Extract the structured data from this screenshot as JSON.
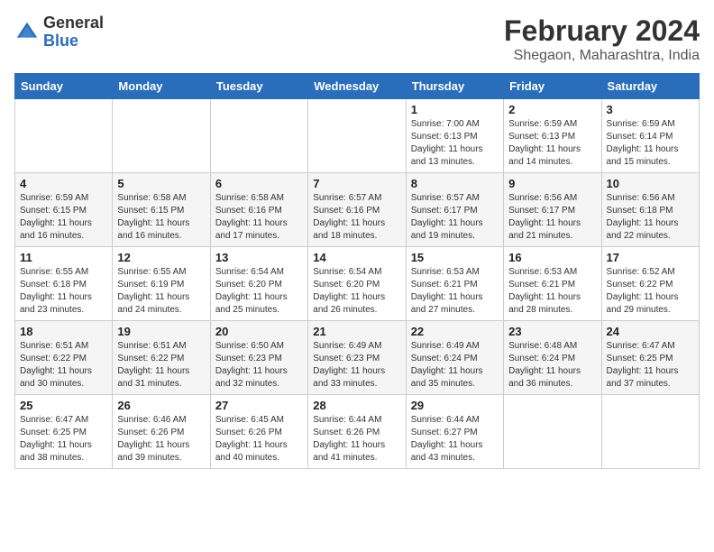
{
  "app": {
    "logo_general": "General",
    "logo_blue": "Blue"
  },
  "title": "February 2024",
  "location": "Shegaon, Maharashtra, India",
  "weekdays": [
    "Sunday",
    "Monday",
    "Tuesday",
    "Wednesday",
    "Thursday",
    "Friday",
    "Saturday"
  ],
  "weeks": [
    [
      {
        "day": "",
        "info": ""
      },
      {
        "day": "",
        "info": ""
      },
      {
        "day": "",
        "info": ""
      },
      {
        "day": "",
        "info": ""
      },
      {
        "day": "1",
        "info": "Sunrise: 7:00 AM\nSunset: 6:13 PM\nDaylight: 11 hours\nand 13 minutes."
      },
      {
        "day": "2",
        "info": "Sunrise: 6:59 AM\nSunset: 6:13 PM\nDaylight: 11 hours\nand 14 minutes."
      },
      {
        "day": "3",
        "info": "Sunrise: 6:59 AM\nSunset: 6:14 PM\nDaylight: 11 hours\nand 15 minutes."
      }
    ],
    [
      {
        "day": "4",
        "info": "Sunrise: 6:59 AM\nSunset: 6:15 PM\nDaylight: 11 hours\nand 16 minutes."
      },
      {
        "day": "5",
        "info": "Sunrise: 6:58 AM\nSunset: 6:15 PM\nDaylight: 11 hours\nand 16 minutes."
      },
      {
        "day": "6",
        "info": "Sunrise: 6:58 AM\nSunset: 6:16 PM\nDaylight: 11 hours\nand 17 minutes."
      },
      {
        "day": "7",
        "info": "Sunrise: 6:57 AM\nSunset: 6:16 PM\nDaylight: 11 hours\nand 18 minutes."
      },
      {
        "day": "8",
        "info": "Sunrise: 6:57 AM\nSunset: 6:17 PM\nDaylight: 11 hours\nand 19 minutes."
      },
      {
        "day": "9",
        "info": "Sunrise: 6:56 AM\nSunset: 6:17 PM\nDaylight: 11 hours\nand 21 minutes."
      },
      {
        "day": "10",
        "info": "Sunrise: 6:56 AM\nSunset: 6:18 PM\nDaylight: 11 hours\nand 22 minutes."
      }
    ],
    [
      {
        "day": "11",
        "info": "Sunrise: 6:55 AM\nSunset: 6:18 PM\nDaylight: 11 hours\nand 23 minutes."
      },
      {
        "day": "12",
        "info": "Sunrise: 6:55 AM\nSunset: 6:19 PM\nDaylight: 11 hours\nand 24 minutes."
      },
      {
        "day": "13",
        "info": "Sunrise: 6:54 AM\nSunset: 6:20 PM\nDaylight: 11 hours\nand 25 minutes."
      },
      {
        "day": "14",
        "info": "Sunrise: 6:54 AM\nSunset: 6:20 PM\nDaylight: 11 hours\nand 26 minutes."
      },
      {
        "day": "15",
        "info": "Sunrise: 6:53 AM\nSunset: 6:21 PM\nDaylight: 11 hours\nand 27 minutes."
      },
      {
        "day": "16",
        "info": "Sunrise: 6:53 AM\nSunset: 6:21 PM\nDaylight: 11 hours\nand 28 minutes."
      },
      {
        "day": "17",
        "info": "Sunrise: 6:52 AM\nSunset: 6:22 PM\nDaylight: 11 hours\nand 29 minutes."
      }
    ],
    [
      {
        "day": "18",
        "info": "Sunrise: 6:51 AM\nSunset: 6:22 PM\nDaylight: 11 hours\nand 30 minutes."
      },
      {
        "day": "19",
        "info": "Sunrise: 6:51 AM\nSunset: 6:22 PM\nDaylight: 11 hours\nand 31 minutes."
      },
      {
        "day": "20",
        "info": "Sunrise: 6:50 AM\nSunset: 6:23 PM\nDaylight: 11 hours\nand 32 minutes."
      },
      {
        "day": "21",
        "info": "Sunrise: 6:49 AM\nSunset: 6:23 PM\nDaylight: 11 hours\nand 33 minutes."
      },
      {
        "day": "22",
        "info": "Sunrise: 6:49 AM\nSunset: 6:24 PM\nDaylight: 11 hours\nand 35 minutes."
      },
      {
        "day": "23",
        "info": "Sunrise: 6:48 AM\nSunset: 6:24 PM\nDaylight: 11 hours\nand 36 minutes."
      },
      {
        "day": "24",
        "info": "Sunrise: 6:47 AM\nSunset: 6:25 PM\nDaylight: 11 hours\nand 37 minutes."
      }
    ],
    [
      {
        "day": "25",
        "info": "Sunrise: 6:47 AM\nSunset: 6:25 PM\nDaylight: 11 hours\nand 38 minutes."
      },
      {
        "day": "26",
        "info": "Sunrise: 6:46 AM\nSunset: 6:26 PM\nDaylight: 11 hours\nand 39 minutes."
      },
      {
        "day": "27",
        "info": "Sunrise: 6:45 AM\nSunset: 6:26 PM\nDaylight: 11 hours\nand 40 minutes."
      },
      {
        "day": "28",
        "info": "Sunrise: 6:44 AM\nSunset: 6:26 PM\nDaylight: 11 hours\nand 41 minutes."
      },
      {
        "day": "29",
        "info": "Sunrise: 6:44 AM\nSunset: 6:27 PM\nDaylight: 11 hours\nand 43 minutes."
      },
      {
        "day": "",
        "info": ""
      },
      {
        "day": "",
        "info": ""
      }
    ]
  ]
}
